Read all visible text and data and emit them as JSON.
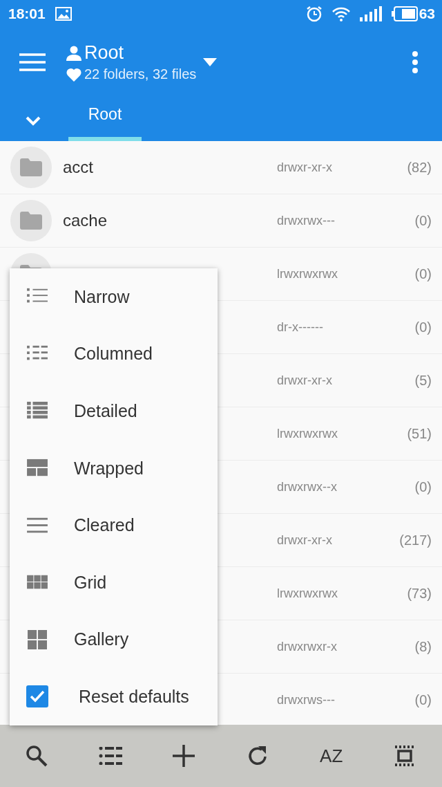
{
  "status_bar": {
    "time": "18:01",
    "battery": "63"
  },
  "app_bar": {
    "title": "Root",
    "subtitle": "22 folders, 32 files"
  },
  "tabs": [
    {
      "label": "Root",
      "selected": true
    }
  ],
  "files": [
    {
      "kind": "folder",
      "name": "acct",
      "permissions": "drwxr-xr-x",
      "count": "(82)"
    },
    {
      "kind": "folder",
      "name": "cache",
      "permissions": "drwxrwx---",
      "count": "(0)"
    },
    {
      "kind": "folder",
      "permissions": "lrwxrwxrwx",
      "count": "(0)"
    },
    {
      "permissions": "dr-x------",
      "count": "(0)"
    },
    {
      "permissions": "drwxr-xr-x",
      "count": "(5)"
    },
    {
      "permissions": "lrwxrwxrwx",
      "count": "(51)"
    },
    {
      "permissions": "drwxrwx--x",
      "count": "(0)"
    },
    {
      "permissions": "drwxr-xr-x",
      "count": "(217)"
    },
    {
      "permissions": "lrwxrwxrwx",
      "count": "(73)"
    },
    {
      "permissions": "drwxrwxr-x",
      "count": "(8)"
    },
    {
      "permissions": "drwxrws---",
      "count": "(0)"
    }
  ],
  "menu_items": [
    {
      "kind": "narrow",
      "label": "Narrow"
    },
    {
      "kind": "columned",
      "label": "Columned"
    },
    {
      "kind": "detailed",
      "label": "Detailed"
    },
    {
      "kind": "wrapped",
      "label": "Wrapped"
    },
    {
      "kind": "cleared",
      "label": "Cleared"
    },
    {
      "kind": "grid",
      "label": "Grid"
    },
    {
      "kind": "gallery",
      "label": "Gallery"
    },
    {
      "kind": "checkbox",
      "label": "Reset defaults",
      "checked": true
    }
  ],
  "toolbar": [
    {
      "kind": "search"
    },
    {
      "kind": "list"
    },
    {
      "kind": "add"
    },
    {
      "kind": "refresh"
    },
    {
      "kind": "sort",
      "label": "AZ"
    },
    {
      "kind": "select"
    }
  ]
}
